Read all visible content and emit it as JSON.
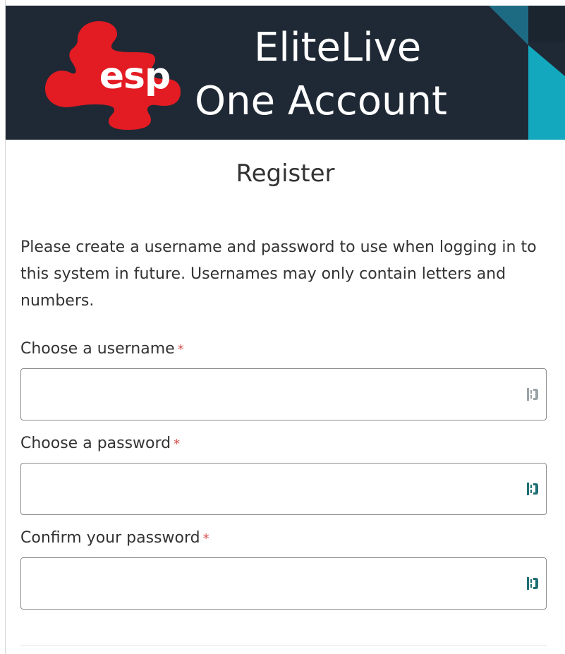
{
  "header": {
    "logo_text": "esp",
    "brand_line1": "EliteLive",
    "brand_line2": "One Account",
    "logo_icon": "puzzle-piece-icon",
    "colors": {
      "header_bg": "#1f2935",
      "logo_red": "#e31b23",
      "accent_teal": "#13a8be",
      "accent_dark_teal": "#1d6b83"
    }
  },
  "page": {
    "title": "Register",
    "intro": "Please create a username and password to use when logging in to this system in future. Usernames may only contain letters and numbers."
  },
  "form": {
    "required_marker": "*",
    "password_manager_icon": "password-manager-icon",
    "fields": [
      {
        "label": "Choose a username",
        "value": "",
        "type": "text"
      },
      {
        "label": "Choose a password",
        "value": "",
        "type": "password"
      },
      {
        "label": "Confirm your password",
        "value": "",
        "type": "password"
      }
    ]
  }
}
